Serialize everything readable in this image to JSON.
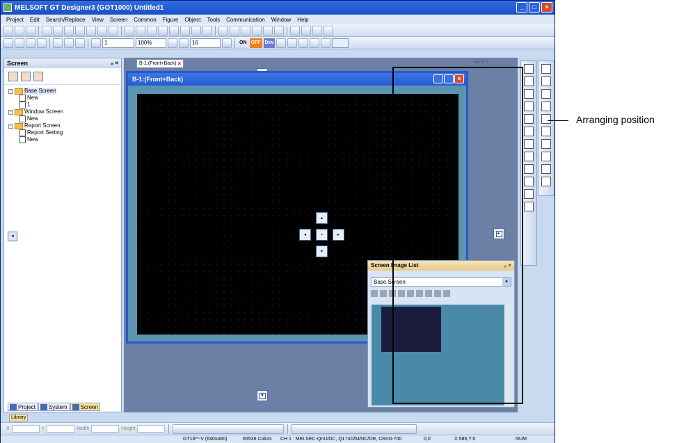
{
  "window": {
    "title": "MELSOFT GT Designer3 (GOT1000) Untitled1"
  },
  "menu": [
    "Project",
    "Edit",
    "Search/Replace",
    "View",
    "Screen",
    "Common",
    "Figure",
    "Object",
    "Tools",
    "Communication",
    "Window",
    "Help"
  ],
  "toolbar2": {
    "screen_no": "1",
    "zoom": "100%",
    "grid": "16",
    "on_label": "ON",
    "off_label": "OFF",
    "dev_label": "Dev"
  },
  "left_panel": {
    "title": "Screen",
    "pin": "₈ ×",
    "tree": [
      {
        "label": "Base Screen",
        "level": 0
      },
      {
        "label": "New",
        "level": 1
      },
      {
        "label": "1",
        "level": 1
      },
      {
        "label": "Window Screen",
        "level": 0
      },
      {
        "label": "New",
        "level": 1
      },
      {
        "label": "Report Screen",
        "level": 0
      },
      {
        "label": "Report Setting",
        "level": 1
      },
      {
        "label": "New",
        "level": 1
      }
    ],
    "tabs": [
      "Project",
      "System",
      "Screen"
    ]
  },
  "library_tab": "Library",
  "editor": {
    "tab_label": "B-1:(Front+Back)",
    "mdi_title": "B-1:(Front+Back)"
  },
  "screen_image_list": {
    "title": "Screen Image List",
    "pin": "₈ ×",
    "selected": "Base Screen"
  },
  "properties": {
    "x_label": "X",
    "y_label": "Y",
    "width_label": "Width",
    "height_label": "Height"
  },
  "status": {
    "device": "GT16**-V (640x480)",
    "colors": "65536 Colors",
    "channel": "CH 1 : MELSEC-QnU/DC, Q17nD/M/NC/DR, CRnD-700",
    "origin": "0,0",
    "coords": "X:586,Y:0",
    "num": "NUM"
  },
  "callout": {
    "text": "Arranging position"
  }
}
